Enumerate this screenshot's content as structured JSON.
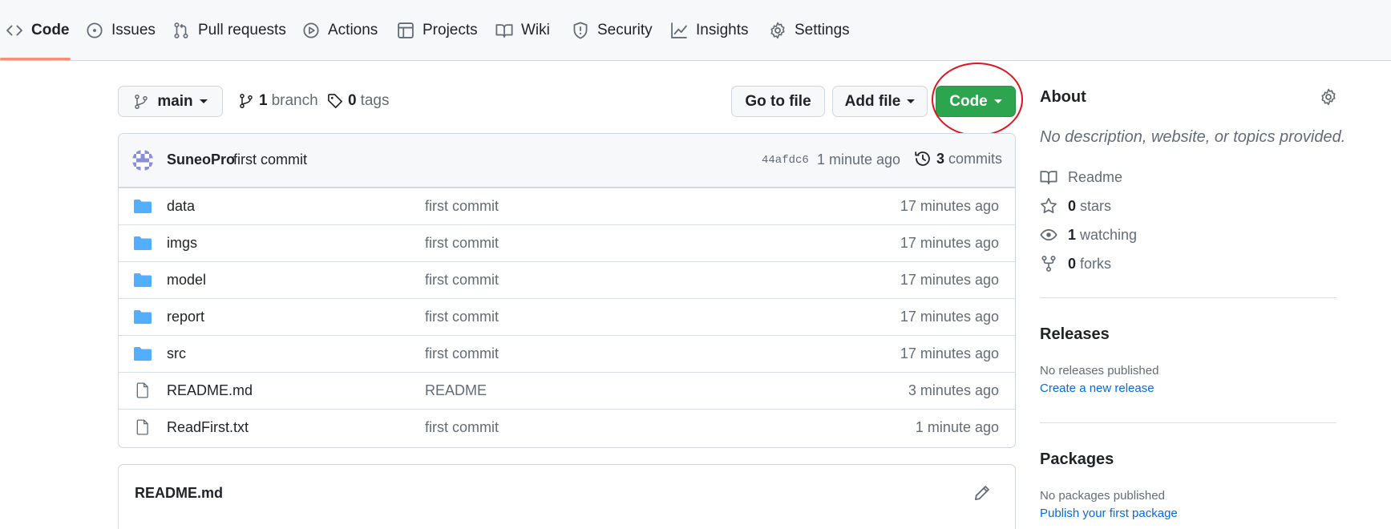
{
  "nav": {
    "tabs": [
      {
        "label": "Code",
        "icon": "code-icon"
      },
      {
        "label": "Issues",
        "icon": "issue-icon"
      },
      {
        "label": "Pull requests",
        "icon": "pull-request-icon"
      },
      {
        "label": "Actions",
        "icon": "play-icon"
      },
      {
        "label": "Projects",
        "icon": "table-icon"
      },
      {
        "label": "Wiki",
        "icon": "book-icon"
      },
      {
        "label": "Security",
        "icon": "shield-icon"
      },
      {
        "label": "Insights",
        "icon": "graph-icon"
      },
      {
        "label": "Settings",
        "icon": "gear-icon"
      }
    ],
    "active_tab": "Code",
    "accent_color": "#fd8c73"
  },
  "branch_bar": {
    "branch_name": "main",
    "branch_count": "1",
    "branch_label": "branch",
    "tag_count": "0",
    "tag_label": "tags",
    "go_to_file": "Go to file",
    "add_file": "Add file",
    "code": "Code",
    "code_color": "#2da44e"
  },
  "commit": {
    "author": "SuneoPro",
    "message": "first commit",
    "sha": "44afdc6",
    "time": "1 minute ago",
    "count": "3",
    "count_label": "commits"
  },
  "files": [
    {
      "name": "data",
      "type": "folder",
      "message": "first commit",
      "time": "17 minutes ago"
    },
    {
      "name": "imgs",
      "type": "folder",
      "message": "first commit",
      "time": "17 minutes ago"
    },
    {
      "name": "model",
      "type": "folder",
      "message": "first commit",
      "time": "17 minutes ago"
    },
    {
      "name": "report",
      "type": "folder",
      "message": "first commit",
      "time": "17 minutes ago"
    },
    {
      "name": "src",
      "type": "folder",
      "message": "first commit",
      "time": "17 minutes ago"
    },
    {
      "name": "README.md",
      "type": "file",
      "message": "README",
      "time": "3 minutes ago"
    },
    {
      "name": "ReadFirst.txt",
      "type": "file",
      "message": "first commit",
      "time": "1 minute ago"
    }
  ],
  "readme": {
    "title": "README.md"
  },
  "about": {
    "title": "About",
    "description": "No description, website, or topics provided.",
    "readme_label": "Readme",
    "stars_count": "0",
    "stars_label": "stars",
    "watching_count": "1",
    "watching_label": "watching",
    "forks_count": "0",
    "forks_label": "forks"
  },
  "releases": {
    "title": "Releases",
    "empty_text": "No releases published",
    "link": "Create a new release"
  },
  "packages": {
    "title": "Packages",
    "empty_text": "No packages published",
    "link": "Publish your first package"
  }
}
